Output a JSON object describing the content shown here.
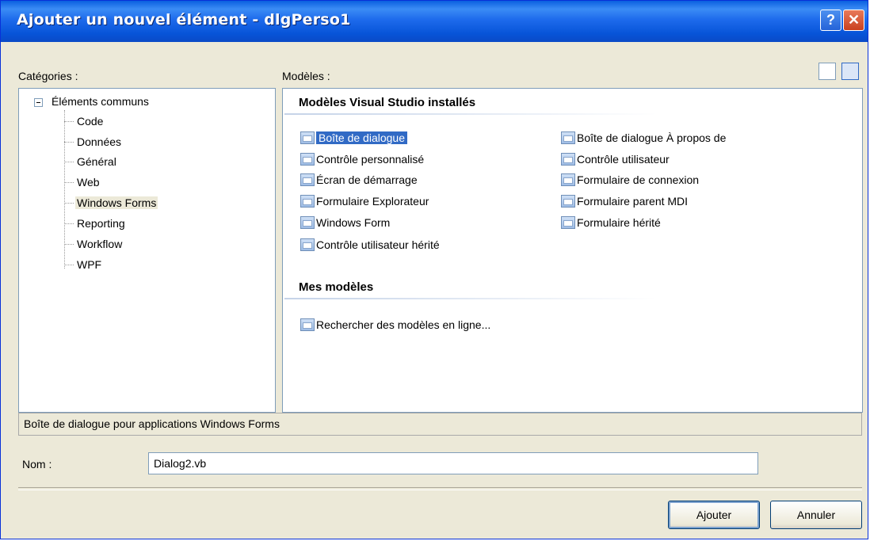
{
  "window": {
    "title": "Ajouter un nouvel élément - dlgPerso1",
    "help_glyph": "?",
    "close_glyph": "✕"
  },
  "categories": {
    "label": "Catégories :",
    "root": "Éléments communs",
    "items": [
      "Code",
      "Données",
      "Général",
      "Web",
      "Windows Forms",
      "Reporting",
      "Workflow",
      "WPF"
    ],
    "selected": "Windows Forms"
  },
  "templates": {
    "label": "Modèles :",
    "installed_header": "Modèles Visual Studio installés",
    "left_column": [
      "Boîte de dialogue",
      "Contrôle personnalisé",
      "Écran de démarrage",
      "Formulaire Explorateur",
      "Windows Form",
      "Contrôle utilisateur hérité"
    ],
    "right_column": [
      "Boîte de dialogue À propos de",
      "Contrôle utilisateur",
      "Formulaire de connexion",
      "Formulaire parent MDI",
      "Formulaire hérité"
    ],
    "selected": "Boîte de dialogue",
    "my_templates_header": "Mes modèles",
    "search_online": "Rechercher des modèles en ligne..."
  },
  "description": "Boîte de dialogue pour applications Windows Forms",
  "name_field": {
    "label": "Nom :",
    "value": "Dialog2.vb"
  },
  "buttons": {
    "add": "Ajouter",
    "cancel": "Annuler"
  },
  "colors": {
    "title_bar": "#0a5fe0",
    "selection": "#316ac5",
    "face": "#ece9d8"
  }
}
